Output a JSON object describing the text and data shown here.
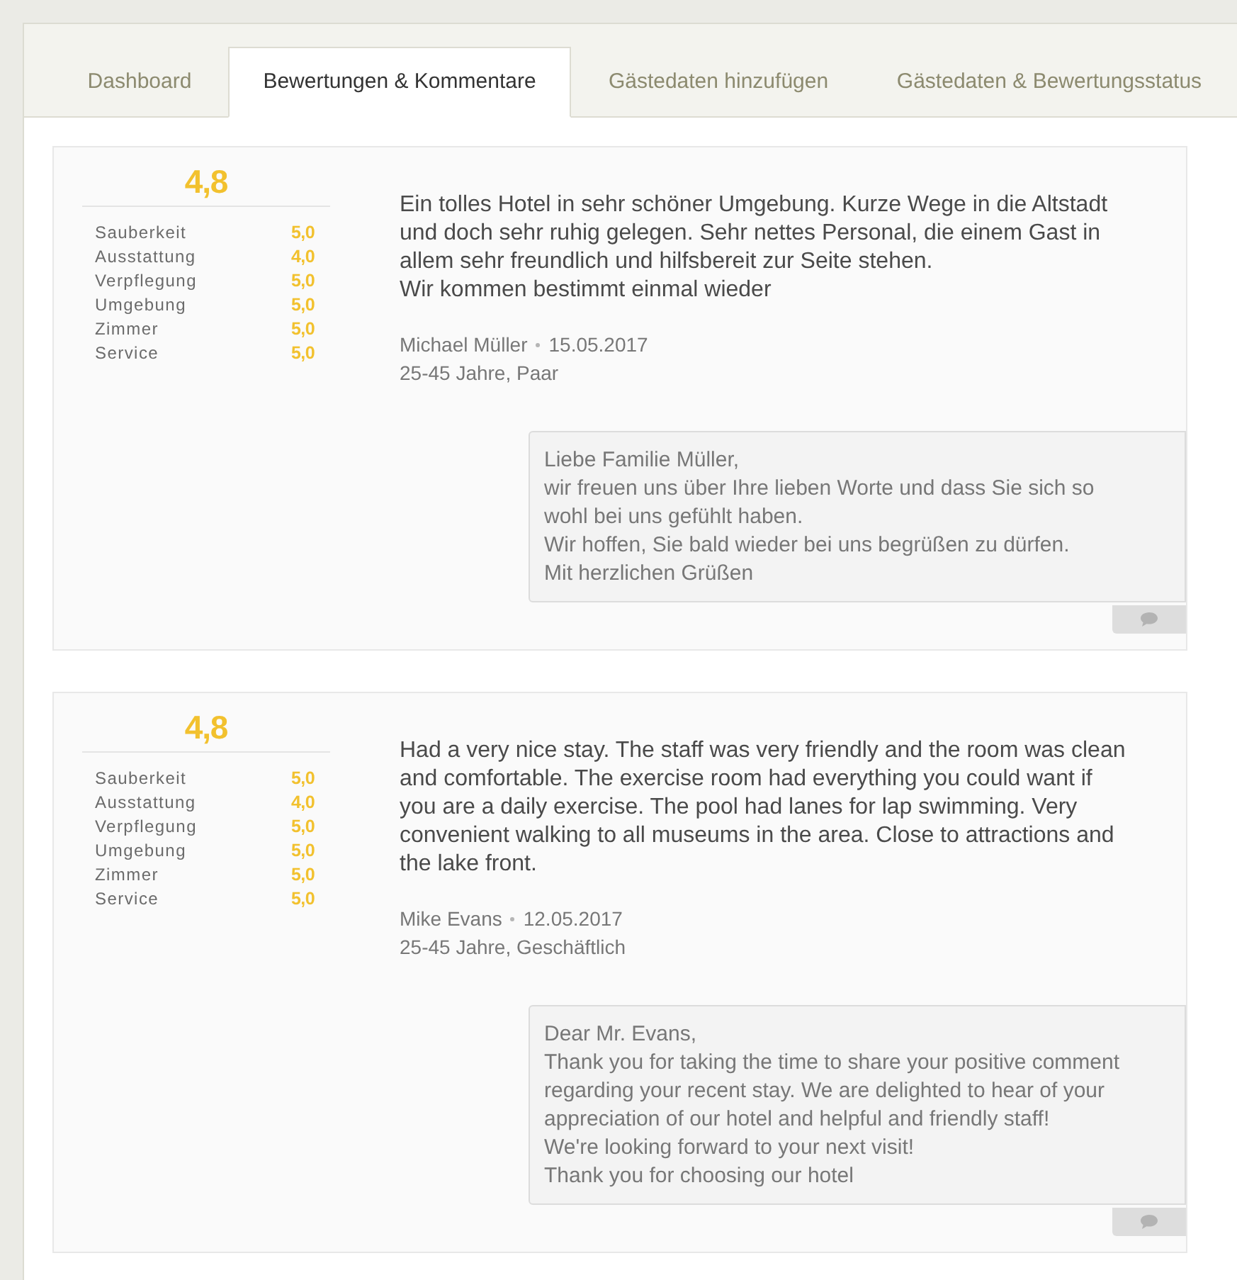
{
  "tabs": [
    {
      "label": "Dashboard",
      "selected": false
    },
    {
      "label": "Bewertungen & Kommentare",
      "selected": true
    },
    {
      "label": "Gästedaten hinzufügen",
      "selected": false
    },
    {
      "label": "Gästedaten & Bewertungsstatus",
      "selected": false
    }
  ],
  "reviews": [
    {
      "overall": "4,8",
      "ratings": [
        {
          "label": "Sauberkeit",
          "value": "5,0"
        },
        {
          "label": "Ausstattung",
          "value": "4,0"
        },
        {
          "label": "Verpflegung",
          "value": "5,0"
        },
        {
          "label": "Umgebung",
          "value": "5,0"
        },
        {
          "label": "Zimmer",
          "value": "5,0"
        },
        {
          "label": "Service",
          "value": "5,0"
        }
      ],
      "text": [
        "Ein tolles Hotel in sehr schöner Umgebung. Kurze Wege in die Altstadt",
        "und doch sehr ruhig gelegen. Sehr nettes Personal, die einem Gast in",
        "allem sehr freundlich und hilfsbereit zur Seite stehen.",
        "Wir kommen bestimmt einmal wieder"
      ],
      "author": "Michael Müller",
      "date": "15.05.2017",
      "guest_info": "25-45 Jahre, Paar",
      "reply": [
        "Liebe Familie Müller,",
        "wir freuen uns über Ihre lieben Worte und dass Sie sich so",
        "wohl bei uns gefühlt haben.",
        "Wir hoffen, Sie bald wieder bei uns begrüßen zu dürfen.",
        "Mit herzlichen Grüßen"
      ]
    },
    {
      "overall": "4,8",
      "ratings": [
        {
          "label": "Sauberkeit",
          "value": "5,0"
        },
        {
          "label": "Ausstattung",
          "value": "4,0"
        },
        {
          "label": "Verpflegung",
          "value": "5,0"
        },
        {
          "label": "Umgebung",
          "value": "5,0"
        },
        {
          "label": "Zimmer",
          "value": "5,0"
        },
        {
          "label": "Service",
          "value": "5,0"
        }
      ],
      "text": [
        "Had a very nice stay. The staff was very friendly and the room was clean",
        "and comfortable. The exercise room had everything you could want if",
        "you are a daily exercise. The pool had lanes for lap swimming. Very",
        "convenient walking to all museums in the area. Close to attractions and",
        "the lake front."
      ],
      "author": "Mike Evans",
      "date": "12.05.2017",
      "guest_info": "25-45 Jahre, Geschäftlich",
      "reply": [
        "Dear Mr. Evans,",
        "Thank you for taking the time to share your positive comment",
        "regarding your recent stay. We are delighted to hear of your",
        "appreciation of our hotel and helpful and friendly staff!",
        "We're looking forward to your next visit!",
        "Thank you for choosing our hotel"
      ]
    }
  ]
}
